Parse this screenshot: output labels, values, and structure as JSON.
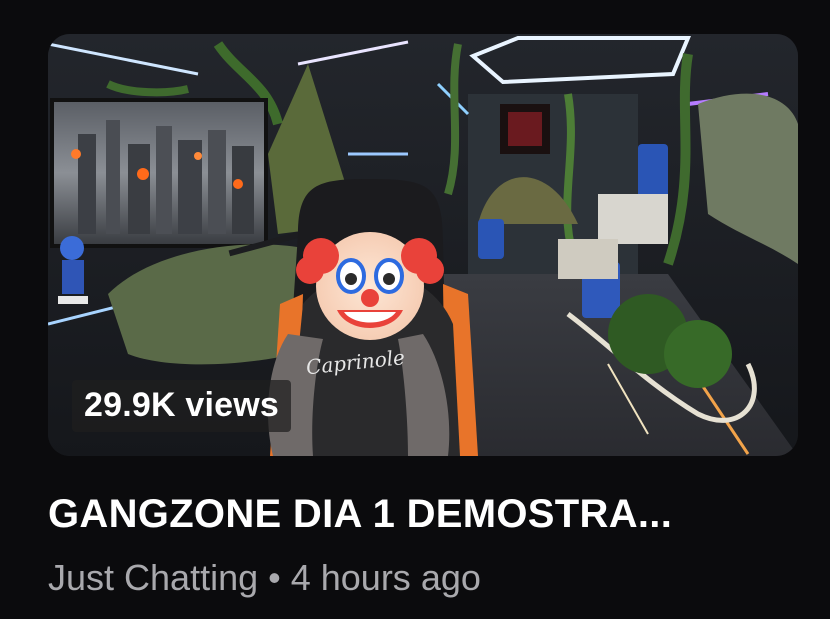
{
  "video": {
    "views": "29.9K views",
    "title": "GANGZONE DIA 1 DEMOSTRA...",
    "category": "Just Chatting",
    "separator": "•",
    "age": "4 hours ago"
  },
  "thumbnail": {
    "overlay_emoji": "🤡",
    "shirt_text": "Caprinole"
  },
  "colors": {
    "background": "#0b0b0d",
    "title": "#ffffff",
    "meta": "#a9a9ad",
    "badge_bg": "rgba(30,30,30,0.72)"
  }
}
